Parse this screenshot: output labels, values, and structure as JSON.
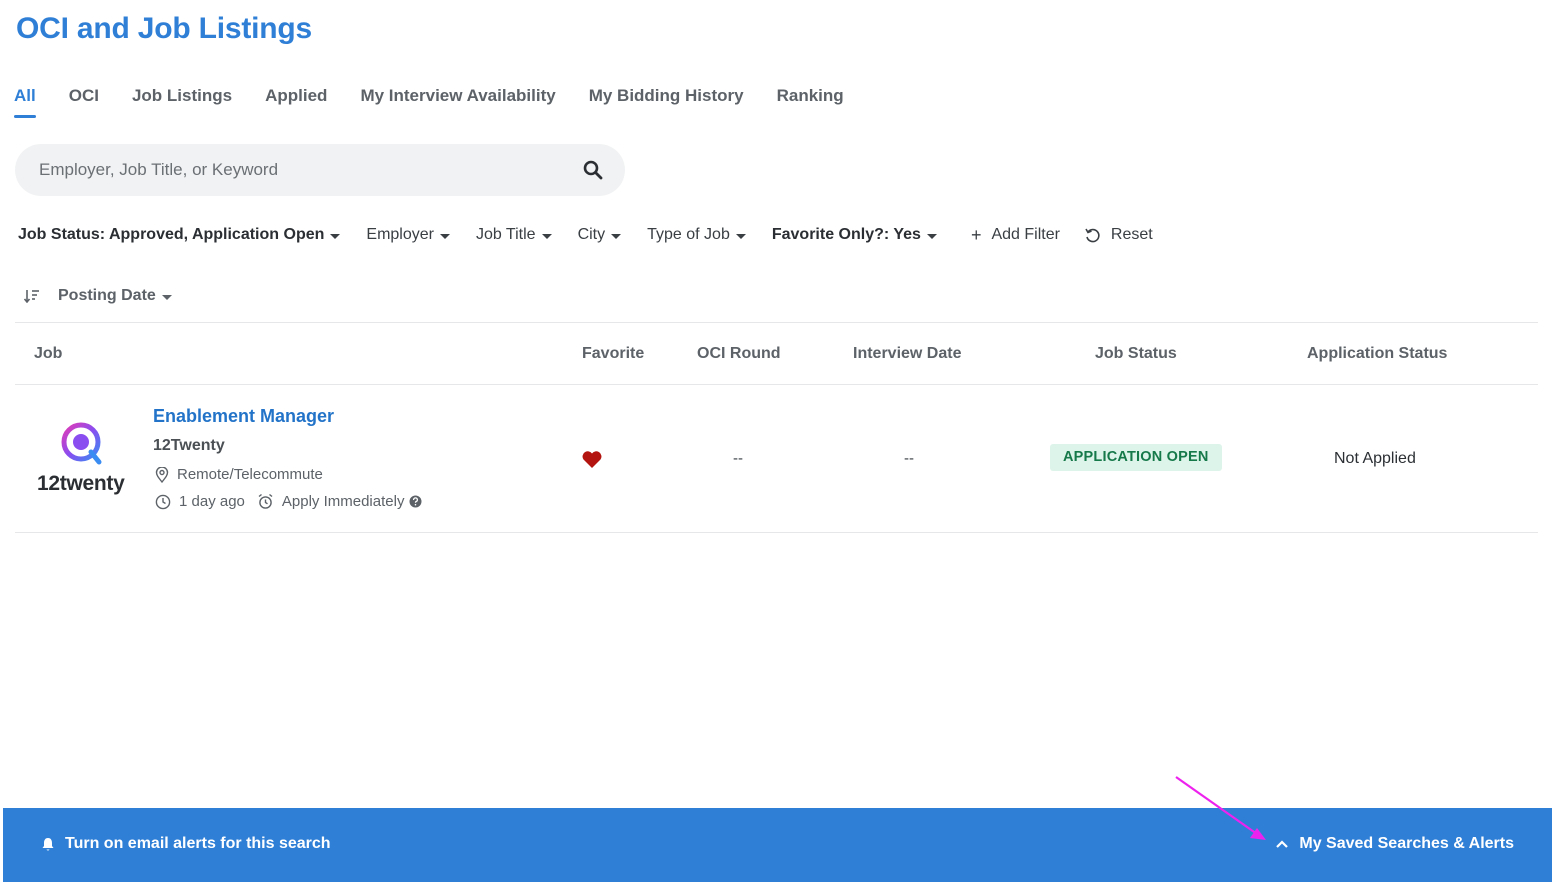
{
  "page_title": "OCI and Job Listings",
  "tabs": [
    {
      "label": "All",
      "active": true
    },
    {
      "label": "OCI"
    },
    {
      "label": "Job Listings"
    },
    {
      "label": "Applied"
    },
    {
      "label": "My Interview Availability"
    },
    {
      "label": "My Bidding History"
    },
    {
      "label": "Ranking"
    }
  ],
  "search": {
    "placeholder": "Employer, Job Title, or Keyword",
    "value": ""
  },
  "filters": {
    "job_status": "Job Status: Approved, Application Open",
    "employer": "Employer",
    "job_title": "Job Title",
    "city": "City",
    "type_of_job": "Type of Job",
    "favorite_only": "Favorite Only?: Yes",
    "add_filter": "Add Filter",
    "reset": "Reset"
  },
  "sort": {
    "label": "Posting Date"
  },
  "table": {
    "headers": {
      "job": "Job",
      "favorite": "Favorite",
      "oci_round": "OCI Round",
      "interview_date": "Interview Date",
      "job_status": "Job Status",
      "application_status": "Application Status"
    },
    "rows": [
      {
        "logo_text": "12twenty",
        "title": "Enablement Manager",
        "employer": "12Twenty",
        "location": "Remote/Telecommute",
        "posted": "1 day ago",
        "deadline": "Apply Immediately",
        "favorite": true,
        "oci_round": "--",
        "interview_date": "--",
        "job_status": "APPLICATION OPEN",
        "application_status": "Not Applied"
      }
    ]
  },
  "bottom_bar": {
    "email_alerts": "Turn on email alerts for this search",
    "saved_searches": "My Saved Searches & Alerts"
  },
  "colors": {
    "accent": "#2f7fd7",
    "link": "#2374c9",
    "heart": "#b3140f",
    "status_bg": "#ddf4ea",
    "status_text": "#16794a",
    "annotation_arrow": "#ee22ee"
  }
}
